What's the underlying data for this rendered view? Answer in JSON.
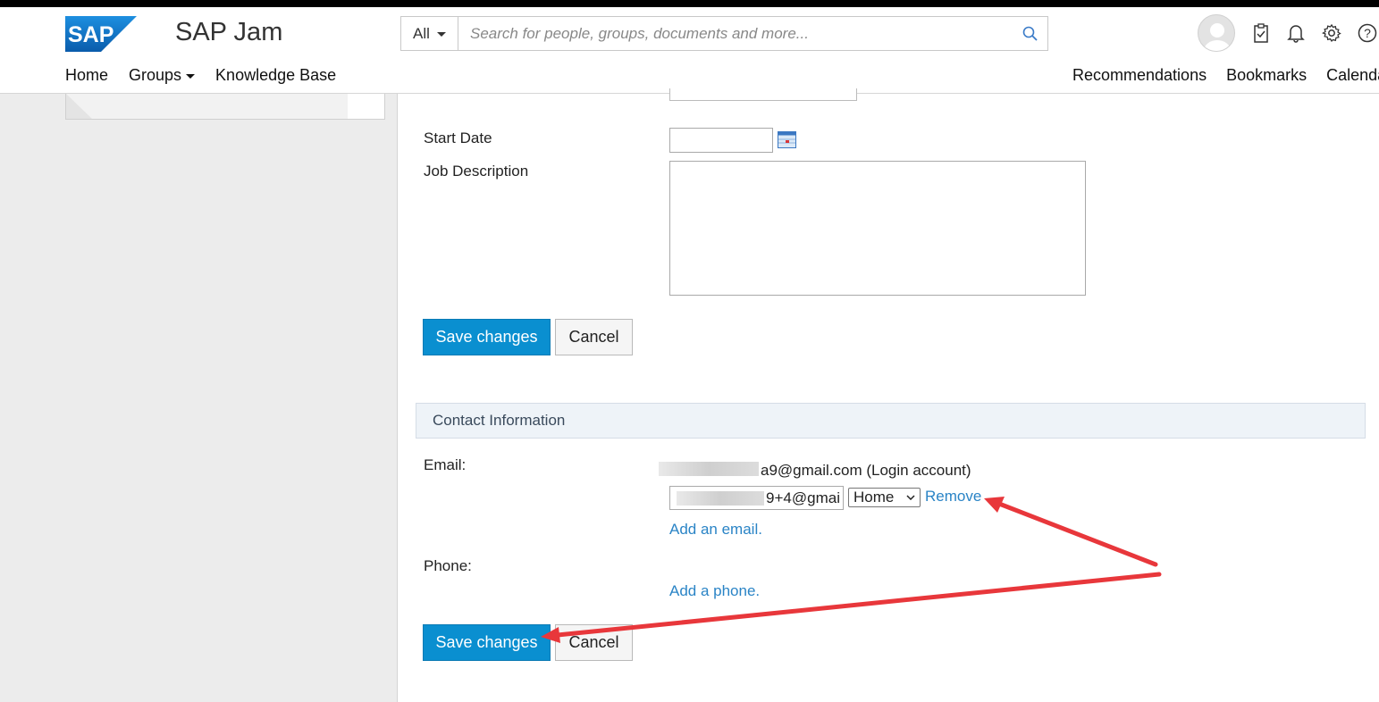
{
  "header": {
    "logo_text": "SAP",
    "app_title": "SAP Jam",
    "search": {
      "scope": "All",
      "placeholder": "Search for people, groups, documents and more..."
    },
    "nav_left": [
      {
        "label": "Home"
      },
      {
        "label": "Groups",
        "has_dropdown": true
      },
      {
        "label": "Knowledge Base"
      }
    ],
    "nav_right": [
      {
        "label": "Recommendations"
      },
      {
        "label": "Bookmarks"
      },
      {
        "label": "Calenda"
      }
    ],
    "icons": [
      "avatar",
      "clipboard-icon",
      "bell-icon",
      "gear-icon",
      "help-icon"
    ]
  },
  "form": {
    "start_date_label": "Start Date",
    "job_description_label": "Job Description",
    "save_label": "Save changes",
    "cancel_label": "Cancel"
  },
  "contact": {
    "section_title": "Contact Information",
    "email_label": "Email:",
    "login_email_suffix": "a9@gmail.com (Login account)",
    "secondary_email_value": "9+4@gmai",
    "email_type": "Home",
    "remove_label": "Remove",
    "add_email_label": "Add an email.",
    "phone_label": "Phone:",
    "add_phone_label": "Add a phone.",
    "save_label": "Save changes",
    "cancel_label": "Cancel"
  },
  "colors": {
    "primary_button": "#0a8fd0",
    "link": "#2a84c6",
    "annotation_arrow": "#e8373b",
    "sap_logo": "#1a7ac8"
  }
}
